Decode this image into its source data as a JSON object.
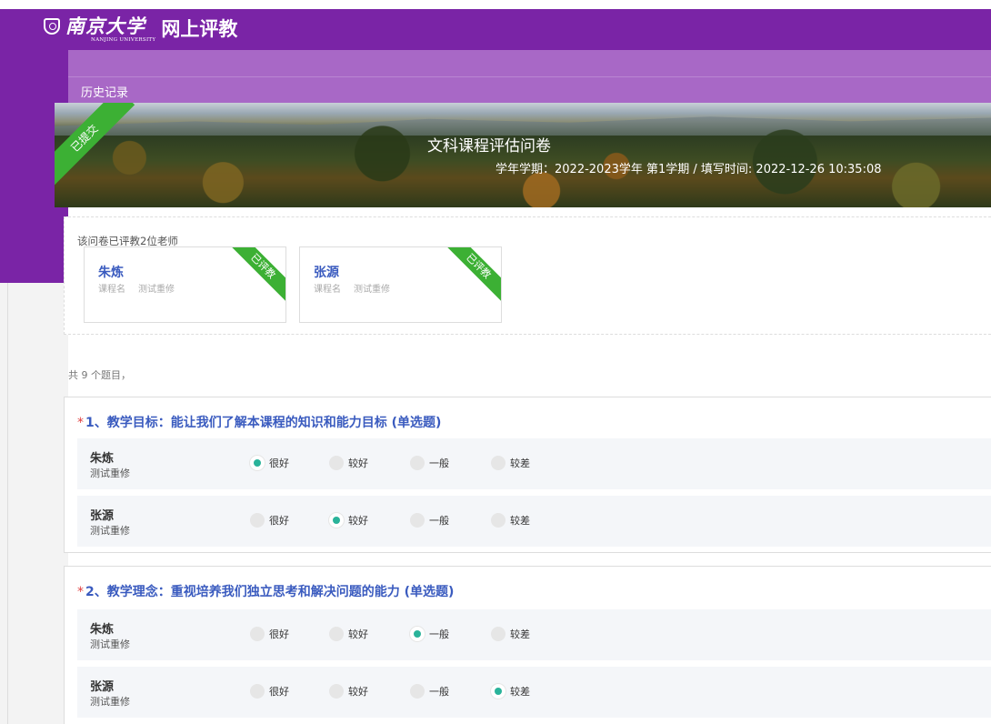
{
  "header": {
    "school_cn": "南京大学",
    "school_en": "NANJING UNIVERSITY",
    "system": "网上评教"
  },
  "nav": {
    "history": "历史记录"
  },
  "banner": {
    "ribbon": "已提交",
    "title": "文科课程评估问卷",
    "meta": "学年学期：2022-2023学年 第1学期 / 填写时间: 2022-12-26 10:35:08"
  },
  "teachers": {
    "note": "该问卷已评教2位老师",
    "cards": [
      {
        "name": "朱炼",
        "course_label": "课程名",
        "course": "测试重修",
        "badge": "已评教"
      },
      {
        "name": "张源",
        "course_label": "课程名",
        "course": "测试重修",
        "badge": "已评教"
      }
    ]
  },
  "total": "共 9 个题目，",
  "options": [
    "很好",
    "较好",
    "一般",
    "较差"
  ],
  "questions": [
    {
      "required_mark": "*",
      "title": "1、教学目标：能让我们了解本课程的知识和能力目标 (单选题)",
      "rows": [
        {
          "name": "朱炼",
          "course": "测试重修",
          "selected": "很好"
        },
        {
          "name": "张源",
          "course": "测试重修",
          "selected": "较好"
        }
      ]
    },
    {
      "required_mark": "*",
      "title": "2、教学理念：重视培养我们独立思考和解决问题的能力 (单选题)",
      "rows": [
        {
          "name": "朱炼",
          "course": "测试重修",
          "selected": "一般"
        },
        {
          "name": "张源",
          "course": "测试重修",
          "selected": "较差"
        }
      ]
    }
  ],
  "colors": {
    "brand_purple": "#7a24a6",
    "nav_purple": "#a868c6",
    "ribbon_green": "#3cb034",
    "title_blue": "#3a5bbf",
    "radio_teal": "#2ab39a"
  }
}
